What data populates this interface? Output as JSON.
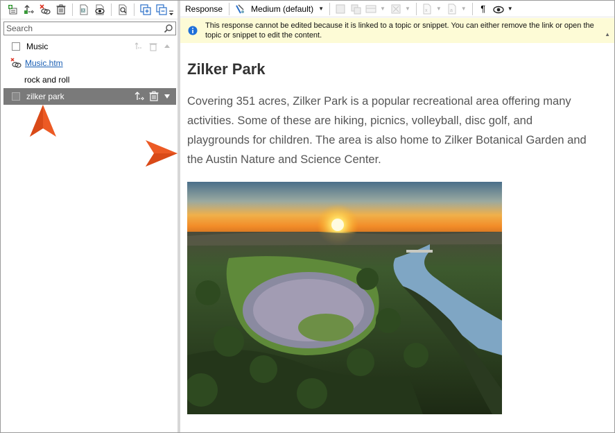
{
  "search": {
    "placeholder": "Search"
  },
  "tree": {
    "items": [
      {
        "label": "Music"
      },
      {
        "label": "Music.htm"
      },
      {
        "label": "rock and roll"
      },
      {
        "label": "zilker park"
      }
    ]
  },
  "editor": {
    "toolbar": {
      "response_label": "Response",
      "size_select": "Medium (default)"
    },
    "infobar_message": "This response cannot be edited because it is linked to a topic or snippet. You can either remove the link or open the topic or snippet to edit the content.",
    "heading": "Zilker Park",
    "body": "Covering 351 acres, Zilker Park is a popular recreational area offering many activities. Some of these are hiking, picnics, volleyball, disc golf, and playgrounds for children. The area is also home to Zilker Botanical Garden and the Austin Nature and Science Center."
  },
  "colors": {
    "selection": "#7a7a7a",
    "callout_arrow": "#ec5a24",
    "info_bar": "#fdfbd6",
    "info_icon": "#1e6fd9",
    "link": "#1a5fb4"
  },
  "icons": {
    "left_toolbar": [
      "add-topic-icon",
      "insert-response-icon",
      "unlink-icon",
      "delete-icon",
      "import-icon",
      "preview-icon",
      "find-icon",
      "copy-icon",
      "paste-icon"
    ],
    "right_toolbar": [
      "text-formatting-icon",
      "image-icon",
      "table-icon",
      "link-icon",
      "pilcrow-icon",
      "view-icon"
    ]
  }
}
